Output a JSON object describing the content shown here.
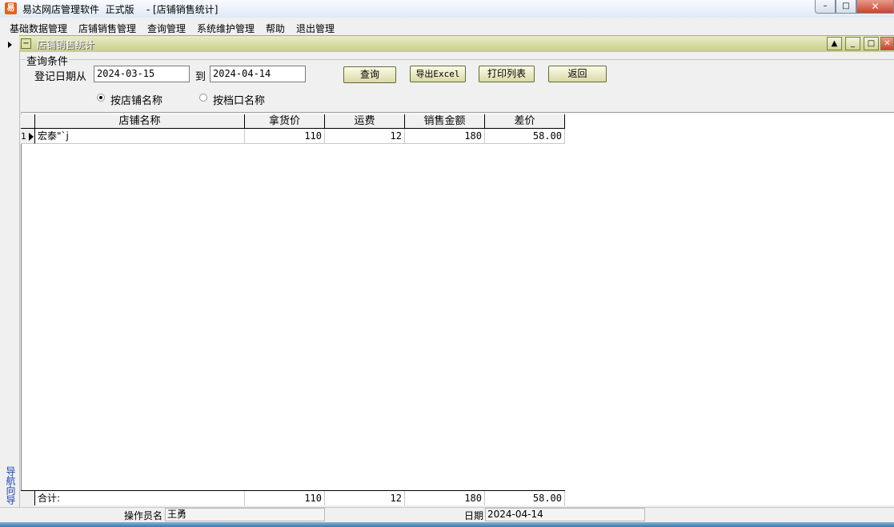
{
  "window": {
    "title": "易达网店管理软件  正式版    - [店铺销售统计]",
    "app_icon_glyph": "易"
  },
  "menu": [
    "基础数据管理",
    "店铺销售管理",
    "查询管理",
    "系统维护管理",
    "帮助",
    "退出管理"
  ],
  "child_window": {
    "title": "店铺销售统计"
  },
  "nav_strip": {
    "label": "导航向导"
  },
  "query": {
    "group_title": "查询条件",
    "from_label": "登记日期从",
    "date_from": "2024-03-15",
    "to_label": "到",
    "date_to": "2024-04-14",
    "buttons": {
      "query": "查询",
      "export": "导出Excel",
      "print": "打印列表",
      "back": "返回"
    },
    "radio_shop": "按店铺名称",
    "radio_stall": "按档口名称",
    "selected": "shop"
  },
  "table": {
    "columns": [
      "店铺名称",
      "拿货价",
      "运费",
      "销售金额",
      "差价"
    ],
    "rows": [
      {
        "index": "1",
        "shop": "宏泰\"`j",
        "cost": "110",
        "freight": "12",
        "sales": "180",
        "diff": "58.00"
      }
    ],
    "footer": {
      "label": "合计:",
      "cost": "110",
      "freight": "12",
      "sales": "180",
      "diff": "58.00"
    }
  },
  "status": {
    "operator_label": "操作员名",
    "operator": "王勇",
    "date_label": "日期",
    "date": "2024-04-14"
  }
}
